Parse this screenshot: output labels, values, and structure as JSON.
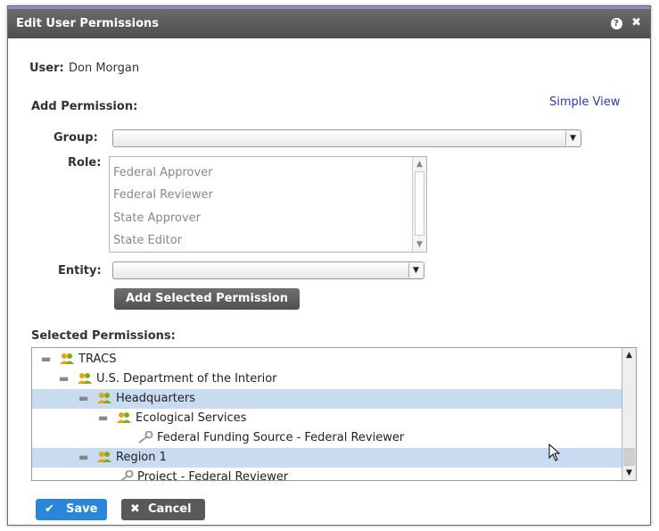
{
  "dialog": {
    "title": "Edit User Permissions",
    "help_icon": "question-icon",
    "close_icon": "close-icon",
    "accent_color": "#9b88c9"
  },
  "user": {
    "label": "User:",
    "name": "Don Morgan"
  },
  "add_permission": {
    "heading": "Add Permission:",
    "simple_view_link": "Simple View",
    "group_label": "Group:",
    "group_value": "",
    "role_label": "Role:",
    "roles": [
      "Federal Approver",
      "Federal Reviewer",
      "State Approver",
      "State Editor"
    ],
    "entity_label": "Entity:",
    "entity_value": "",
    "add_button": "Add Selected Permission"
  },
  "selected_permissions": {
    "heading": "Selected Permissions:",
    "rows": [
      {
        "text": "TRACS",
        "icon": "group-icon",
        "highlighted": false
      },
      {
        "text": "U.S. Department of the Interior",
        "icon": "group-icon",
        "highlighted": false
      },
      {
        "text": "Headquarters",
        "icon": "group-icon",
        "highlighted": true
      },
      {
        "text": "Ecological Services",
        "icon": "group-icon",
        "highlighted": false
      },
      {
        "text": "Federal Funding Source - Federal Reviewer",
        "icon": "key-icon",
        "highlighted": false
      },
      {
        "text": "Region 1",
        "icon": "group-icon",
        "highlighted": true
      },
      {
        "text": "Project - Federal Reviewer",
        "icon": "key-icon",
        "highlighted": false
      }
    ],
    "highlight_color": "#c9dbf0"
  },
  "footer": {
    "save_label": "Save",
    "cancel_label": "Cancel",
    "save_color": "#2a86db",
    "cancel_color": "#595959"
  }
}
